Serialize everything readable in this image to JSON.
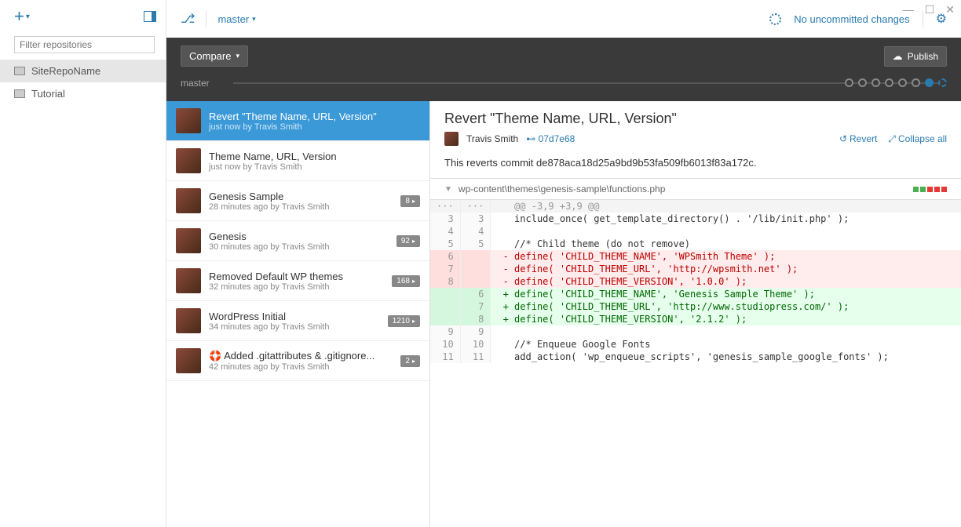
{
  "window": {
    "uncommitted": "No uncommitted changes"
  },
  "sidebar": {
    "filter_placeholder": "Filter repositories",
    "repos": [
      {
        "name": "SiteRepoName"
      },
      {
        "name": "Tutorial"
      }
    ]
  },
  "branch": {
    "current": "master",
    "compare_label": "Compare",
    "publish_label": "Publish",
    "timeline_label": "master"
  },
  "commits": [
    {
      "title": "Revert \"Theme Name, URL, Version\"",
      "sub": "just now by Travis Smith",
      "badge": "",
      "selected": true
    },
    {
      "title": "Theme Name, URL, Version",
      "sub": "just now by Travis Smith",
      "badge": ""
    },
    {
      "title": "Genesis Sample",
      "sub": "28 minutes ago by Travis Smith",
      "badge": "8"
    },
    {
      "title": "Genesis",
      "sub": "30 minutes ago by Travis Smith",
      "badge": "92"
    },
    {
      "title": "Removed Default WP themes",
      "sub": "32 minutes ago by Travis Smith",
      "badge": "168"
    },
    {
      "title": "WordPress Initial",
      "sub": "34 minutes ago by Travis Smith",
      "badge": "1210"
    },
    {
      "title": "🛟 Added .gitattributes & .gitignore...",
      "sub": "42 minutes ago by Travis Smith",
      "badge": "2"
    }
  ],
  "detail": {
    "title": "Revert \"Theme Name, URL, Version\"",
    "author": "Travis Smith",
    "hash": "07d7e68",
    "revert_label": "Revert",
    "collapse_label": "Collapse all",
    "message": "This reverts commit de878aca18d25a9bd9b53fa509fb6013f83a172c.",
    "file": "wp-content\\themes\\genesis-sample\\functions.php"
  },
  "diff": {
    "hunk": "@@ -3,9 +3,9 @@",
    "lines": [
      {
        "o": "3",
        "n": "3",
        "t": "   include_once( get_template_directory() . '/lib/init.php' );",
        "c": ""
      },
      {
        "o": "4",
        "n": "4",
        "t": "",
        "c": ""
      },
      {
        "o": "5",
        "n": "5",
        "t": "   //* Child theme (do not remove)",
        "c": ""
      },
      {
        "o": "6",
        "n": "",
        "t": " - define( 'CHILD_THEME_NAME', 'WPSmith Theme' );",
        "c": "del"
      },
      {
        "o": "7",
        "n": "",
        "t": " - define( 'CHILD_THEME_URL', 'http://wpsmith.net' );",
        "c": "del"
      },
      {
        "o": "8",
        "n": "",
        "t": " - define( 'CHILD_THEME_VERSION', '1.0.0' );",
        "c": "del"
      },
      {
        "o": "",
        "n": "6",
        "t": " + define( 'CHILD_THEME_NAME', 'Genesis Sample Theme' );",
        "c": "add"
      },
      {
        "o": "",
        "n": "7",
        "t": " + define( 'CHILD_THEME_URL', 'http://www.studiopress.com/' );",
        "c": "add"
      },
      {
        "o": "",
        "n": "8",
        "t": " + define( 'CHILD_THEME_VERSION', '2.1.2' );",
        "c": "add"
      },
      {
        "o": "9",
        "n": "9",
        "t": "",
        "c": ""
      },
      {
        "o": "10",
        "n": "10",
        "t": "   //* Enqueue Google Fonts",
        "c": ""
      },
      {
        "o": "11",
        "n": "11",
        "t": "   add_action( 'wp_enqueue_scripts', 'genesis_sample_google_fonts' );",
        "c": ""
      }
    ]
  }
}
